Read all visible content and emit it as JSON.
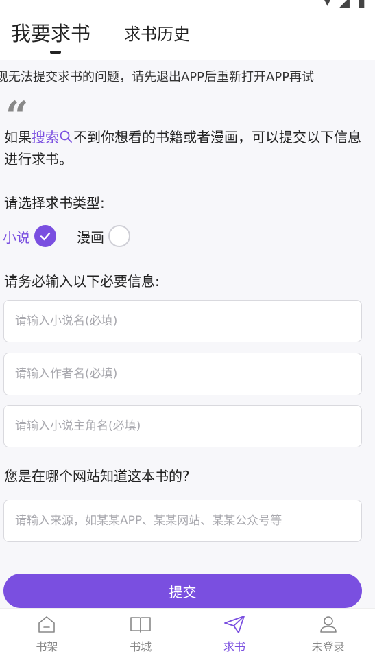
{
  "header": {
    "tab_request": "我要求书",
    "tab_history": "求书历史"
  },
  "notice": "现无法提交求书的问题，请先退出APP后重新打开APP再试",
  "intro": {
    "before": "如果",
    "link": "搜索",
    "after": "不到你想看的书籍或者漫画，可以提交以下信息进行求书。"
  },
  "type_section": {
    "label": "请选择求书类型:",
    "options": [
      {
        "label": "小说",
        "selected": true
      },
      {
        "label": "漫画",
        "selected": false
      }
    ]
  },
  "required_section": {
    "label": "请务必输入以下必要信息:",
    "fields": [
      {
        "placeholder": "请输入小说名(必填)",
        "value": ""
      },
      {
        "placeholder": "请输入作者名(必填)",
        "value": ""
      },
      {
        "placeholder": "请输入小说主角名(必填)",
        "value": ""
      }
    ]
  },
  "source_section": {
    "label": "您是在哪个网站知道这本书的?",
    "placeholder": "请输入来源，如某某APP、某某网站、某某公众号等",
    "value": ""
  },
  "submit_label": "提交",
  "bottom_nav": [
    {
      "label": "书架",
      "icon": "bookshelf-icon",
      "active": false
    },
    {
      "label": "书城",
      "icon": "book-open-icon",
      "active": false
    },
    {
      "label": "求书",
      "icon": "paper-plane-icon",
      "active": true
    },
    {
      "label": "未登录",
      "icon": "user-icon",
      "active": false
    }
  ],
  "colors": {
    "accent": "#7a4fe0",
    "background": "#f7f7fa",
    "inactive": "#888888"
  }
}
